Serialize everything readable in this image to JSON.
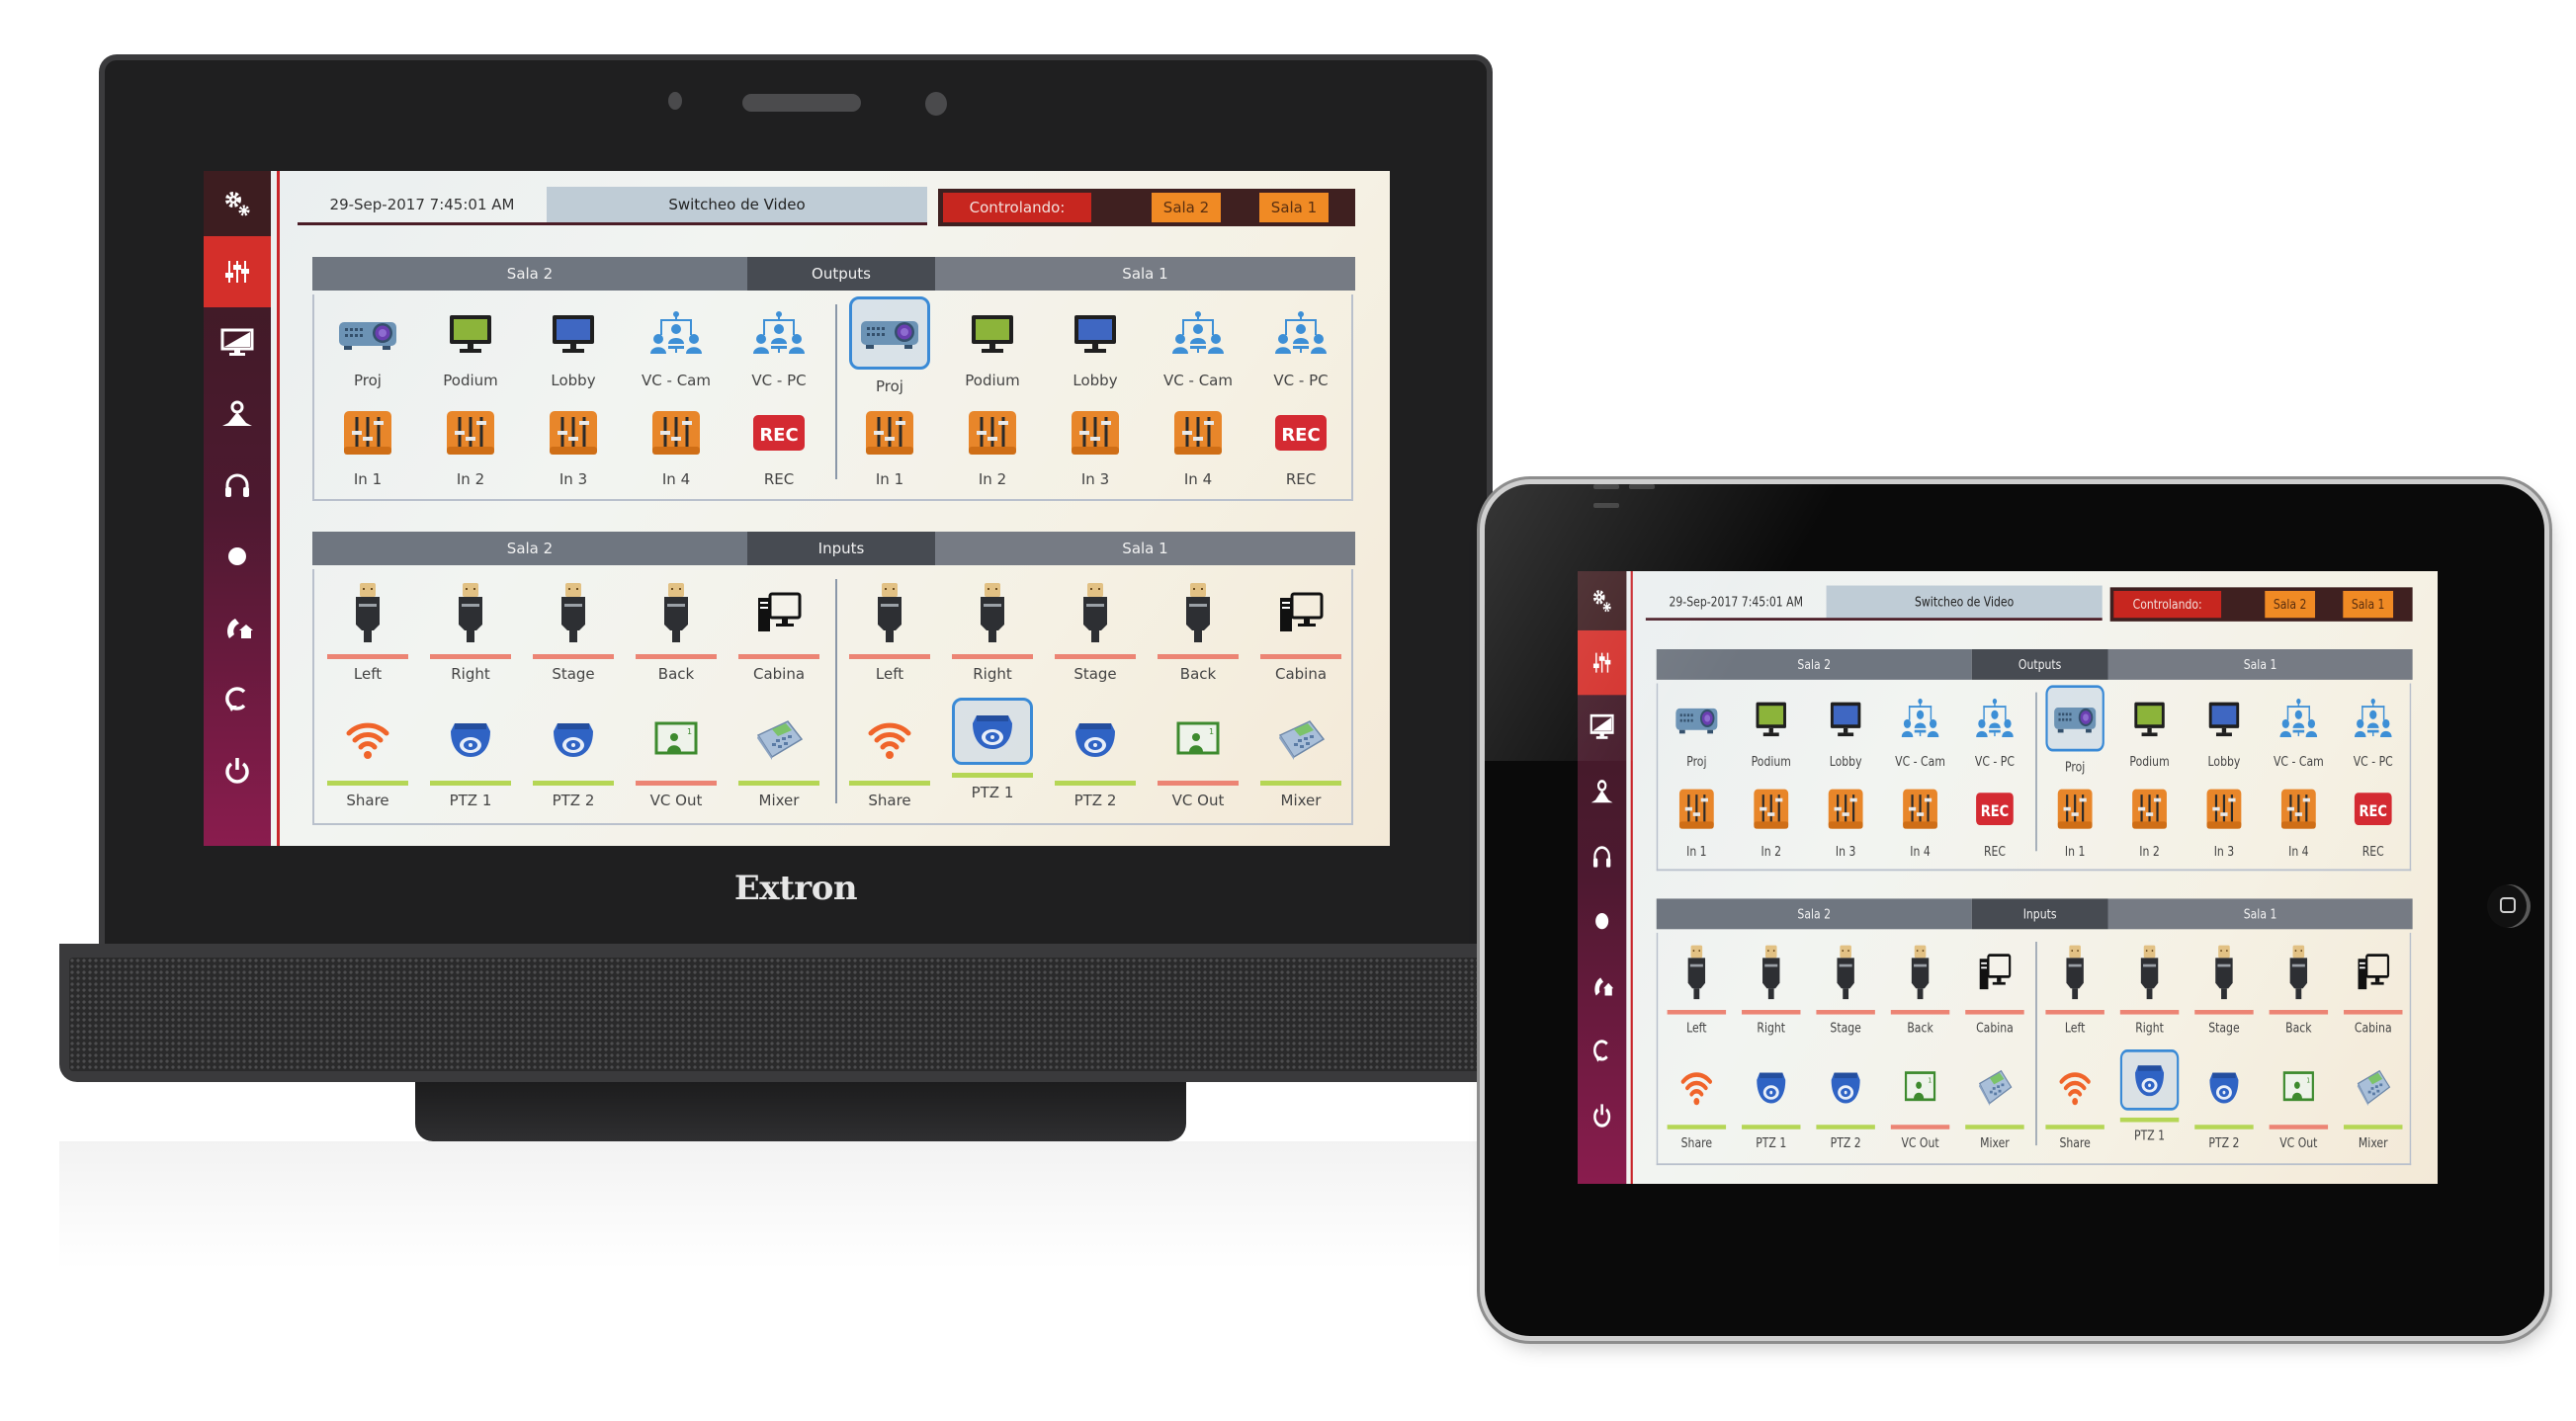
{
  "devices": {
    "extron": {
      "brand": "Extron"
    },
    "ipad": {}
  },
  "app": {
    "sidebar": {
      "items": [
        {
          "icon": "gears-icon",
          "glyph": "⚙",
          "active": false
        },
        {
          "icon": "sliders-icon",
          "glyph": "",
          "active": true
        },
        {
          "icon": "display-icon",
          "glyph": "",
          "active": false
        },
        {
          "icon": "presenter-icon",
          "glyph": "",
          "active": false
        },
        {
          "icon": "headphones-icon",
          "glyph": "",
          "active": false
        },
        {
          "icon": "record-dot-icon",
          "glyph": "●",
          "active": false
        },
        {
          "icon": "phone-home-icon",
          "glyph": "",
          "active": false
        },
        {
          "icon": "refresh-icon",
          "glyph": "",
          "active": false
        },
        {
          "icon": "power-icon",
          "glyph": "⏻",
          "active": false
        }
      ]
    },
    "topbar": {
      "datetime": "29-Sep-2017 7:45:01 AM",
      "title": "Switcheo de Video",
      "controlling_label": "Controlando:",
      "room_buttons": [
        "Sala 2",
        "Sala 1"
      ]
    },
    "outputs": {
      "header": {
        "left": "Sala 2",
        "mid": "Outputs",
        "right": "Sala 1"
      },
      "rooms": [
        {
          "name": "Sala 2",
          "displays": [
            {
              "label": "Proj",
              "icon": "projector-icon",
              "selected": false
            },
            {
              "label": "Podium",
              "icon": "monitor-green-icon",
              "selected": false
            },
            {
              "label": "Lobby",
              "icon": "monitor-blue-icon",
              "selected": false
            },
            {
              "label": "VC - Cam",
              "icon": "videoconference-icon",
              "selected": false
            },
            {
              "label": "VC - PC",
              "icon": "videoconference-icon",
              "selected": false
            }
          ],
          "audio": [
            {
              "label": "In 1",
              "icon": "mixer-fader-icon"
            },
            {
              "label": "In 2",
              "icon": "mixer-fader-icon"
            },
            {
              "label": "In 3",
              "icon": "mixer-fader-icon"
            },
            {
              "label": "In 4",
              "icon": "mixer-fader-icon"
            },
            {
              "label": "REC",
              "icon": "rec-icon"
            }
          ]
        },
        {
          "name": "Sala 1",
          "displays": [
            {
              "label": "Proj",
              "icon": "projector-icon",
              "selected": true
            },
            {
              "label": "Podium",
              "icon": "monitor-green-icon",
              "selected": false
            },
            {
              "label": "Lobby",
              "icon": "monitor-blue-icon",
              "selected": false
            },
            {
              "label": "VC - Cam",
              "icon": "videoconference-icon",
              "selected": false
            },
            {
              "label": "VC - PC",
              "icon": "videoconference-icon",
              "selected": false
            }
          ],
          "audio": [
            {
              "label": "In 1",
              "icon": "mixer-fader-icon"
            },
            {
              "label": "In 2",
              "icon": "mixer-fader-icon"
            },
            {
              "label": "In 3",
              "icon": "mixer-fader-icon"
            },
            {
              "label": "In 4",
              "icon": "mixer-fader-icon"
            },
            {
              "label": "REC",
              "icon": "rec-icon"
            }
          ]
        }
      ]
    },
    "inputs": {
      "header": {
        "left": "Sala 2",
        "mid": "Inputs",
        "right": "Sala 1"
      },
      "rooms": [
        {
          "name": "Sala 2",
          "sources": [
            {
              "label": "Left",
              "icon": "hdmi-icon",
              "status": "red",
              "selected": false
            },
            {
              "label": "Right",
              "icon": "hdmi-icon",
              "status": "red",
              "selected": false
            },
            {
              "label": "Stage",
              "icon": "hdmi-icon",
              "status": "red",
              "selected": false
            },
            {
              "label": "Back",
              "icon": "hdmi-icon",
              "status": "red",
              "selected": false
            },
            {
              "label": "Cabina",
              "icon": "desktop-pc-icon",
              "status": "red",
              "selected": false
            },
            {
              "label": "Share",
              "icon": "wifi-icon",
              "status": "green",
              "selected": false
            },
            {
              "label": "PTZ 1",
              "icon": "dome-camera-icon",
              "status": "green",
              "selected": false
            },
            {
              "label": "PTZ 2",
              "icon": "dome-camera-icon",
              "status": "green",
              "selected": false
            },
            {
              "label": "VC Out",
              "icon": "vc-screen-icon",
              "status": "red",
              "selected": false
            },
            {
              "label": "Mixer",
              "icon": "video-mixer-icon",
              "status": "green",
              "selected": false
            }
          ]
        },
        {
          "name": "Sala 1",
          "sources": [
            {
              "label": "Left",
              "icon": "hdmi-icon",
              "status": "red",
              "selected": false
            },
            {
              "label": "Right",
              "icon": "hdmi-icon",
              "status": "red",
              "selected": false
            },
            {
              "label": "Stage",
              "icon": "hdmi-icon",
              "status": "red",
              "selected": false
            },
            {
              "label": "Back",
              "icon": "hdmi-icon",
              "status": "red",
              "selected": false
            },
            {
              "label": "Cabina",
              "icon": "desktop-pc-icon",
              "status": "red",
              "selected": false
            },
            {
              "label": "Share",
              "icon": "wifi-icon",
              "status": "green",
              "selected": false
            },
            {
              "label": "PTZ 1",
              "icon": "dome-camera-icon",
              "status": "green",
              "selected": true
            },
            {
              "label": "PTZ 2",
              "icon": "dome-camera-icon",
              "status": "green",
              "selected": false
            },
            {
              "label": "VC Out",
              "icon": "vc-screen-icon",
              "status": "red",
              "selected": false
            },
            {
              "label": "Mixer",
              "icon": "video-mixer-icon",
              "status": "green",
              "selected": false
            }
          ]
        }
      ]
    },
    "colors": {
      "accent_red": "#d42f2a",
      "room_orange": "#f08a24",
      "status_red": "#ec8474",
      "status_green": "#b5d655",
      "selected_blue": "#3a8ad6"
    }
  }
}
